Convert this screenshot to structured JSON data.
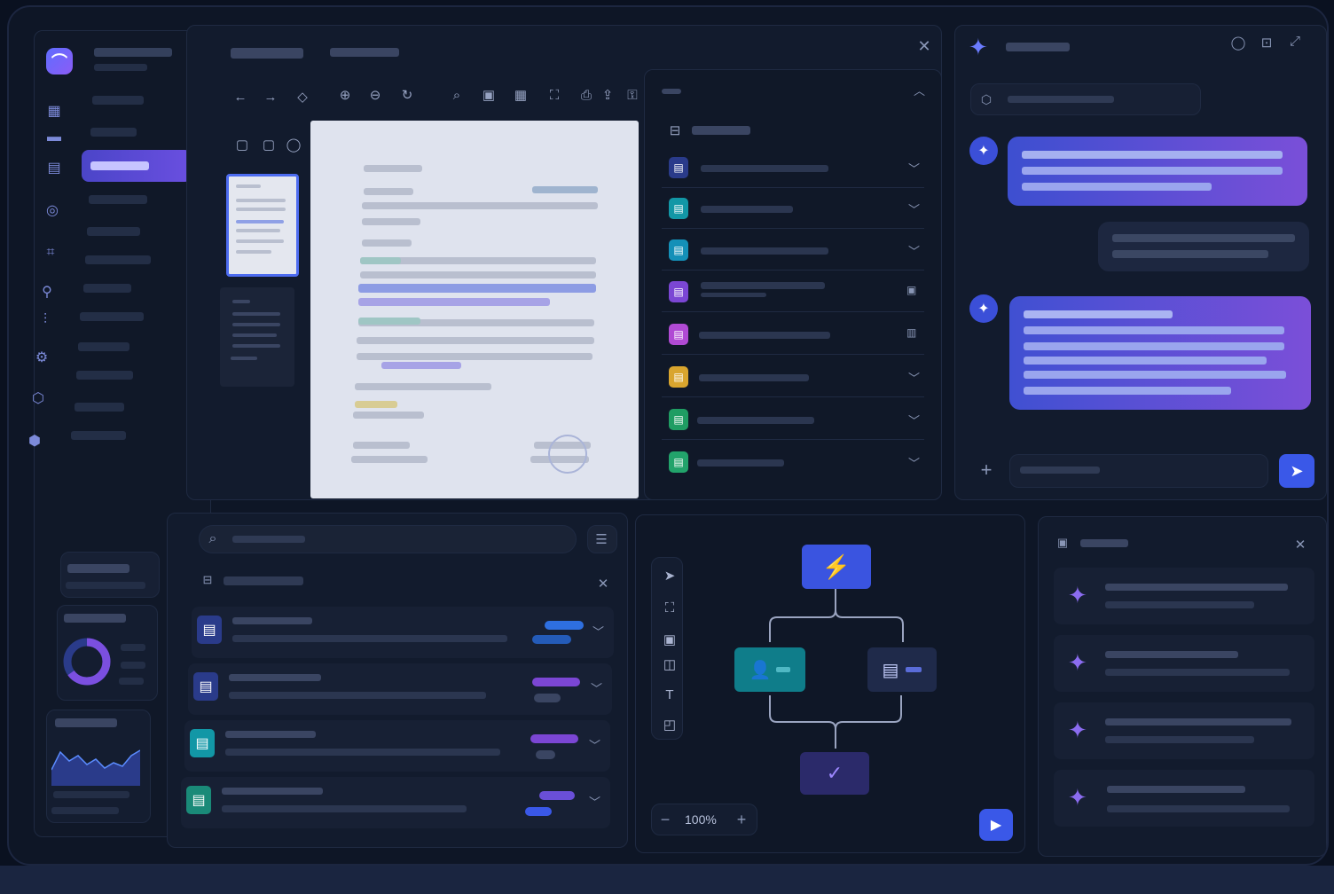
{
  "flow": {
    "zoom_label": "100%"
  },
  "icons": {
    "logo": "app-logo",
    "close": "close-icon",
    "sparkle": "sparkle-icon",
    "send": "send-icon",
    "play": "play-icon",
    "lightning": "lightning-icon",
    "check": "check-icon",
    "search": "search-icon",
    "filter": "filter-icon"
  },
  "colors": {
    "accent": "#3b4fd8",
    "accent_purple": "#7b4fe0",
    "background": "#0e1626",
    "panel": "#121b2d",
    "node_teal": "#0f7d8a"
  }
}
